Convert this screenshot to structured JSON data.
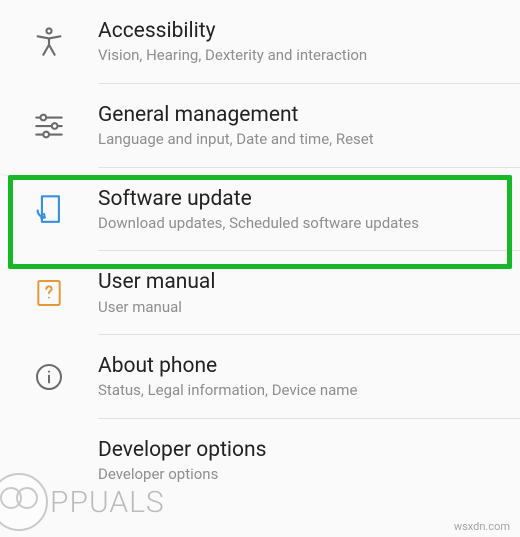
{
  "settings_items": [
    {
      "id": "accessibility",
      "title": "Accessibility",
      "subtitle": "Vision, Hearing, Dexterity and interaction",
      "icon": "accessibility-icon",
      "highlighted": false
    },
    {
      "id": "general-management",
      "title": "General management",
      "subtitle": "Language and input, Date and time, Reset",
      "icon": "sliders-icon",
      "highlighted": false
    },
    {
      "id": "software-update",
      "title": "Software update",
      "subtitle": "Download updates, Scheduled software updates",
      "icon": "update-icon",
      "highlighted": true
    },
    {
      "id": "user-manual",
      "title": "User manual",
      "subtitle": "User manual",
      "icon": "manual-icon",
      "highlighted": false
    },
    {
      "id": "about-phone",
      "title": "About phone",
      "subtitle": "Status, Legal information, Device name",
      "icon": "info-icon",
      "highlighted": false
    },
    {
      "id": "developer-options",
      "title": "Developer options",
      "subtitle": "Developer options",
      "icon": "none",
      "highlighted": false
    }
  ],
  "icon_colors": {
    "accessibility-icon": "#6b6b6b",
    "sliders-icon": "#6b6b6b",
    "update-icon": "#3a8fe0",
    "manual-icon": "#e09a3a",
    "info-icon": "#6b6b6b"
  },
  "watermark_left": "PPUALS",
  "watermark_right": "wsxdn.com"
}
